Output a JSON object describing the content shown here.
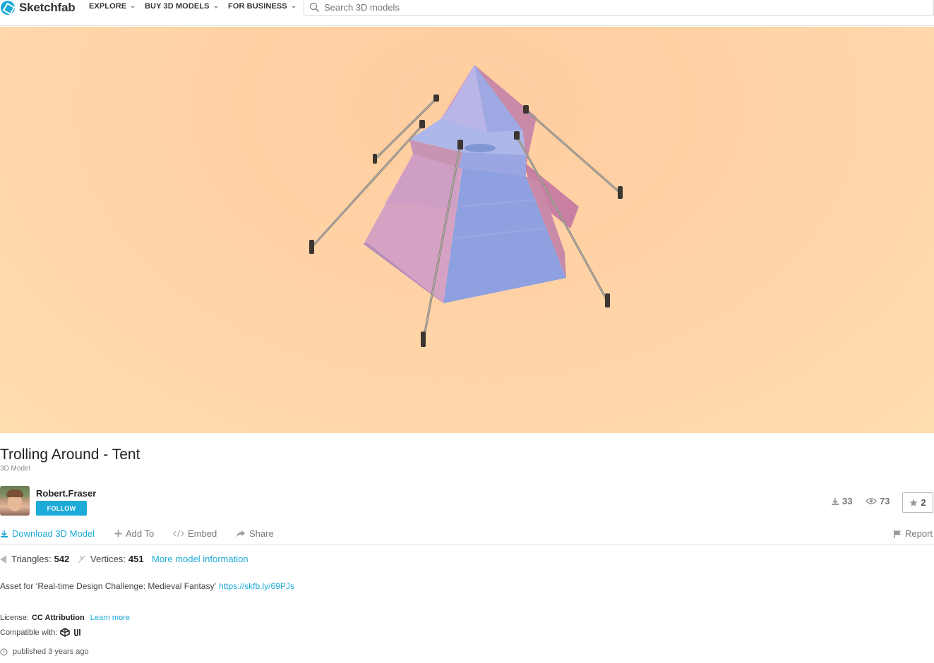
{
  "header": {
    "logo_text": "Sketchfab",
    "nav": [
      "EXPLORE",
      "BUY 3D MODELS",
      "FOR BUSINESS"
    ],
    "search_placeholder": "Search 3D models"
  },
  "model": {
    "title": "Trolling Around - Tent",
    "subtitle": "3D Model"
  },
  "author": {
    "name": "Robert.Fraser",
    "follow_label": "FOLLOW"
  },
  "stats": {
    "downloads": "33",
    "views": "73",
    "likes": "2"
  },
  "actions": {
    "download": "Download 3D Model",
    "add_to": "Add To",
    "embed": "Embed",
    "share": "Share",
    "report": "Report"
  },
  "meta": {
    "triangles_label": "Triangles:",
    "triangles": "542",
    "vertices_label": "Vertices:",
    "vertices": "451",
    "more_info": "More model information"
  },
  "description": {
    "text": "Asset for ‘Real-time Design Challenge: Medieval Fantasy’",
    "link": "https://skfb.ly/69PJs"
  },
  "license": {
    "label": "License:",
    "value": "CC Attribution",
    "learn_more": "Learn more",
    "compatible_label": "Compatible with:"
  },
  "published": "published 3 years ago",
  "colors": {
    "accent": "#1caad9",
    "viewer_bg": "#ffd3a6",
    "tent_blue": "#8f9fe0",
    "tent_pink": "#d99aba"
  }
}
